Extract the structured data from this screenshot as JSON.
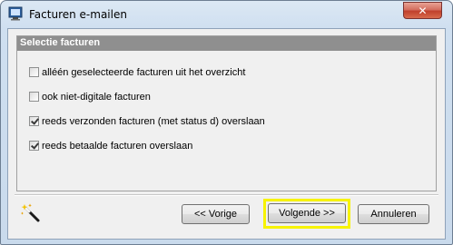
{
  "window": {
    "title": "Facturen e-mailen",
    "close_glyph": "✕"
  },
  "group": {
    "title": "Selectie facturen",
    "options": [
      {
        "label": "alléén geselecteerde facturen uit het overzicht",
        "checked": false
      },
      {
        "label": "ook niet-digitale facturen",
        "checked": false
      },
      {
        "label": "reeds verzonden facturen (met status d) overslaan",
        "checked": true
      },
      {
        "label": "reeds betaalde facturen overslaan",
        "checked": true
      }
    ]
  },
  "buttons": {
    "prev": "<< Vorige",
    "next": "Volgende >>",
    "cancel": "Annuleren"
  },
  "icons": {
    "app": "app-icon",
    "close": "close-icon",
    "wizard": "magic-wand-icon"
  },
  "colors": {
    "focus_highlight": "#f7f300",
    "group_header": "#8f8f8f",
    "close_button": "#c8483a"
  }
}
